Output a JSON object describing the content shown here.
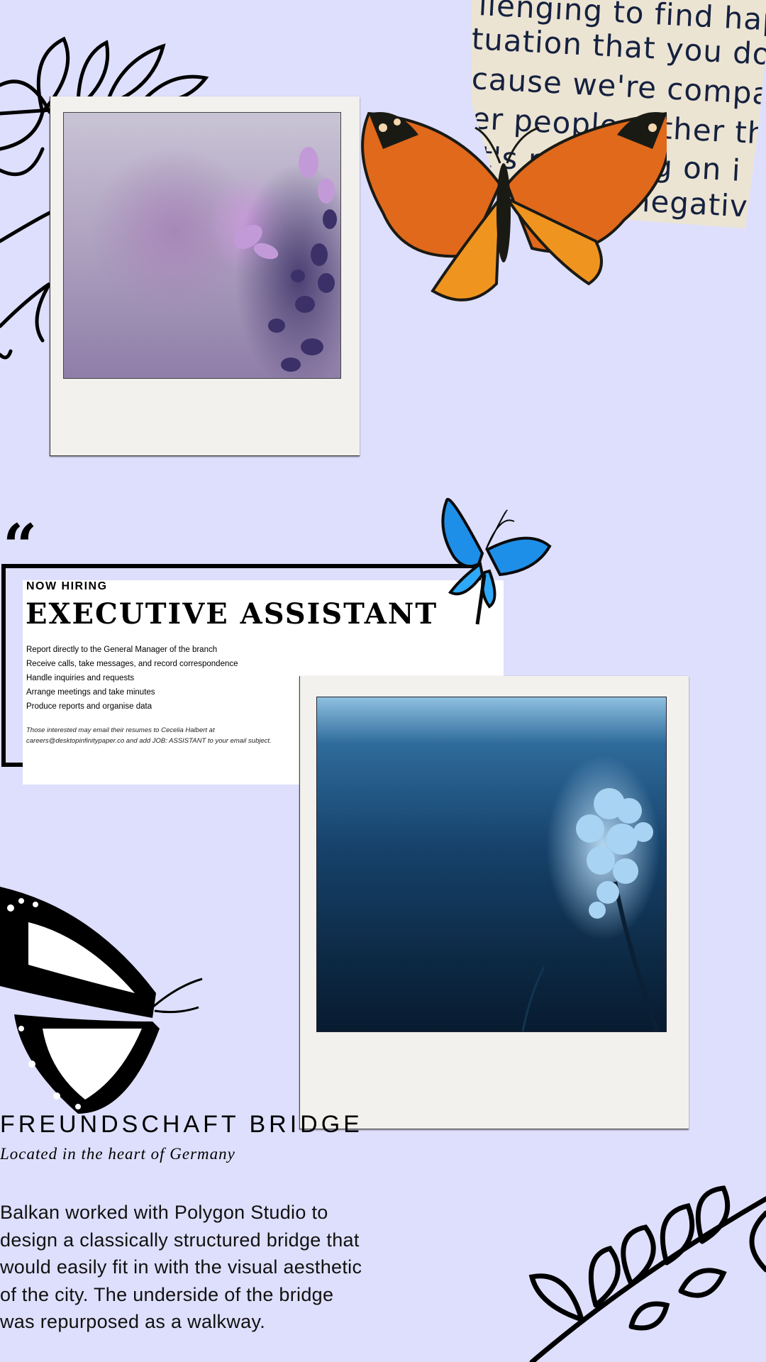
{
  "note": {
    "lines": [
      "llenging  to find hap",
      "tuation that you don'",
      "cause we're compari",
      "er people rather tha",
      "it's  really  ing on i",
      "negativ"
    ]
  },
  "quote": {
    "mark": "“",
    "eyebrow": "NOW HIRING",
    "title": "EXECUTIVE ASSISTANT",
    "duties": [
      "Report directly to the General Manager of the branch",
      "Receive calls, take messages, and record correspondence",
      "Handle inquiries and requests",
      "Arrange meetings and take minutes",
      "Produce reports and organise data"
    ],
    "contact_line1": "Those interested may email their resumes to Cecelia Halbert at",
    "contact_line2": "careers@desktopinfinitypaper.co and add JOB: ASSISTANT to your email subject."
  },
  "bridge": {
    "title": "FREUNDSCHAFT BRIDGE",
    "subtitle": "Located in the heart of Germany",
    "body": "Balkan worked with Polygon Studio to design a classically structured bridge that would easily fit in with the visual aesthetic of the city. The underside of the bridge was repurposed as a walkway."
  },
  "colors": {
    "background": "#dedffc",
    "note_paper": "#ece4d3",
    "note_ink": "#15213f",
    "orange_butterfly": "#e06a1c",
    "blue_butterfly": "#1e8fe8"
  },
  "icons": [
    "leaf-branch-icon",
    "orange-butterfly-icon",
    "blue-butterfly-icon",
    "monarch-butterfly-icon",
    "quote-icon"
  ]
}
